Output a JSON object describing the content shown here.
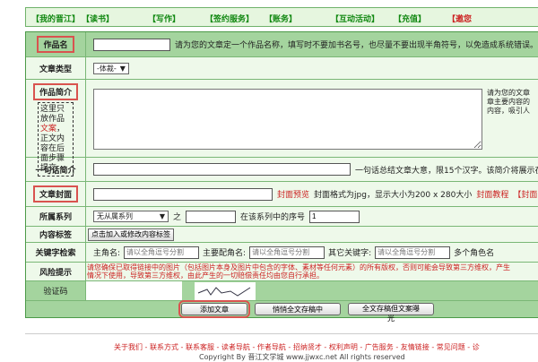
{
  "nav": [
    "【我的晋江】",
    "【读书】",
    "【写作】",
    "【签约服务】",
    "【账务】",
    "【互动活动】",
    "【充值】",
    "【邀您"
  ],
  "form": {
    "title": {
      "label": "作品名",
      "hint": "请为您的文章定一个作品名称，填写时不要加书名号，也尽量不要出现半角符号，以免造成系统错误。"
    },
    "type": {
      "label": "文章类型",
      "select": "-体裁-"
    },
    "intro": {
      "label": "作品简介",
      "note_a": "这里只放作品",
      "note_red": "文案",
      "note_b": "，正文内容在后面步骤提交",
      "hint": "请为您的文章\n章主要内容的\n内容，吸引人"
    },
    "oneline": {
      "label": "一句话简介",
      "hint": "一句话总结文章大意，限15个汉字。该简介将展示在文"
    },
    "cover": {
      "label": "文章封面",
      "preview": "封面预览",
      "hint": "封面格式为jpg，显示大小为200 x 280大小",
      "tutorial": "封面教程",
      "more": "【封面"
    },
    "series": {
      "label": "所属系列",
      "select": "无从属系列",
      "zhi": "之",
      "order_label": "在该系列中的序号",
      "order_value": "1"
    },
    "tags": {
      "label": "内容标签",
      "button": "点击加入或修改内容标签"
    },
    "keywords": {
      "label": "关键字检索",
      "main": "主角名:",
      "support": "主要配角名:",
      "other": "其它关键字:",
      "placeholder": "请以全角逗号分割",
      "more": "多个角色名"
    },
    "risk": {
      "label": "风险提示",
      "text1": "请您确保已取得链接中的图片（包括图片本身及图片中包含的字体、素材等任何元素）的所有版权，否则可能会导致第三方维权，产生",
      "text2": "情况下使用，导致第三方维权，由此产生的一切赔偿责任均由您自行承担。"
    },
    "captcha": {
      "label": "验证码"
    },
    "buttons": [
      "添加文章",
      "悄悄全文存稿中",
      "全文存稿但文案曝光"
    ]
  },
  "footer": {
    "links": "关于我们 - 联系方式 - 联系客服 - 读者导航 - 作者导航 - 招纳贤才 - 权利声明 - 广告服务 - 友情链接 - 常见问题 - 诊",
    "copyright": "Copyright By 晋江文学城 www.jjwxc.net All rights reserved"
  },
  "colors": {
    "accent": "#118811",
    "header_row": "#a4d49e",
    "row_bg": "#eef9ea",
    "highlight": "#d9534f"
  }
}
